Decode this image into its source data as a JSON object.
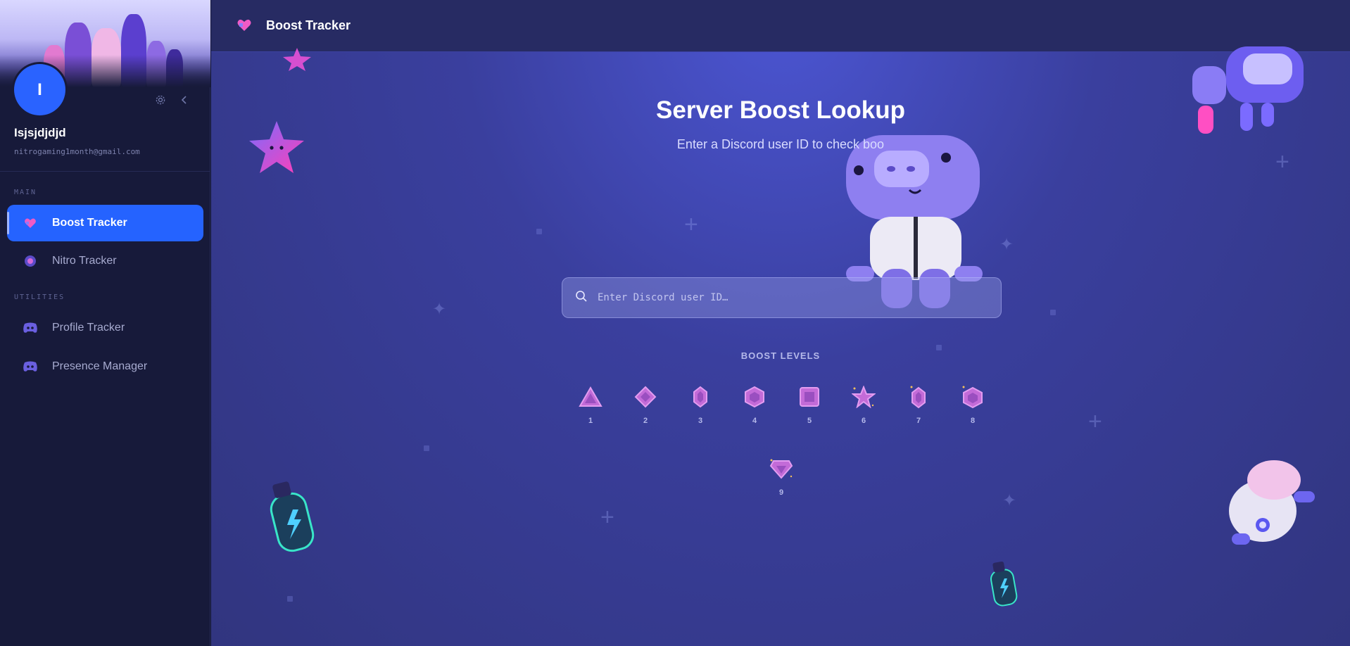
{
  "sidebar": {
    "avatar_initial": "I",
    "username": "Isjsjdjdjd",
    "email": "nitrogaming1month@gmail.com",
    "sections": [
      {
        "label": "MAIN"
      },
      {
        "label": "UTILITIES"
      }
    ],
    "items": [
      {
        "label": "Boost Tracker",
        "icon": "boost-icon",
        "active": true
      },
      {
        "label": "Nitro Tracker",
        "icon": "nitro-icon",
        "active": false
      },
      {
        "label": "Profile Tracker",
        "icon": "discord-icon",
        "active": false
      },
      {
        "label": "Presence Manager",
        "icon": "discord-icon",
        "active": false
      }
    ],
    "settings_icon": "gear-icon",
    "collapse_icon": "chevron-left-icon"
  },
  "topbar": {
    "title": "Boost Tracker",
    "icon": "boost-icon"
  },
  "main": {
    "heading": "Server Boost Lookup",
    "subheading": "Enter a Discord user ID to check boo",
    "search": {
      "placeholder": "Enter Discord user ID…",
      "value": "",
      "icon": "search-icon"
    },
    "levels_label": "BOOST LEVELS",
    "levels": [
      "1",
      "2",
      "3",
      "4",
      "5",
      "6",
      "7",
      "8",
      "9"
    ]
  },
  "colors": {
    "accent": "#2563ff",
    "sidebar_bg": "#171a3a",
    "main_bg": "#3a3f9e",
    "gem": "#c36bd8"
  }
}
